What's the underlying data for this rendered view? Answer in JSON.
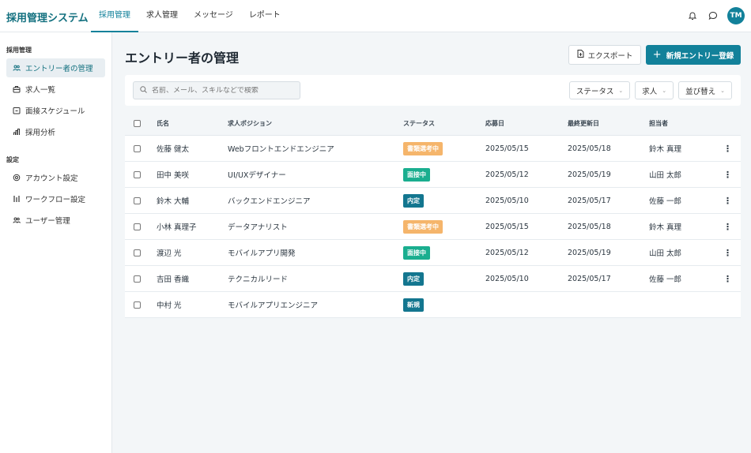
{
  "header": {
    "brand": "採用管理システム",
    "tabs": [
      "採用管理",
      "求人管理",
      "メッセージ",
      "レポート"
    ],
    "avatar": "TM"
  },
  "sidebar": {
    "section1": "採用管理",
    "items1": [
      {
        "label": "エントリー者の管理",
        "icon": "users-icon"
      },
      {
        "label": "求人一覧",
        "icon": "briefcase-icon"
      },
      {
        "label": "面接スケジュール",
        "icon": "calendar-icon"
      },
      {
        "label": "採用分析",
        "icon": "chart-icon"
      }
    ],
    "section2": "設定",
    "items2": [
      {
        "label": "アカウント設定",
        "icon": "gear-icon"
      },
      {
        "label": "ワークフロー設定",
        "icon": "workflow-icon"
      },
      {
        "label": "ユーザー管理",
        "icon": "users-icon"
      }
    ]
  },
  "main": {
    "title": "エントリー者の管理",
    "export_label": "エクスポート",
    "new_label": "新規エントリー登録",
    "search_placeholder": "名前、メール、スキルなどで検索",
    "filters": [
      "ステータス",
      "求人",
      "並び替え"
    ]
  },
  "colors": {
    "accent": "#12819a",
    "review": "#f5b56b",
    "interview": "#1aae8f",
    "offer": "#13768f",
    "new": "#13768f"
  },
  "table": {
    "headers": [
      "氏名",
      "求人ポジション",
      "ステータス",
      "応募日",
      "最終更新日",
      "担当者"
    ],
    "rows": [
      {
        "name": "佐藤 健太",
        "position": "Webフロントエンドエンジニア",
        "status": "書類選考中",
        "status_color": "#f5b56b",
        "applied": "2025/05/15",
        "updated": "2025/05/18",
        "owner": "鈴木 真理"
      },
      {
        "name": "田中 美咲",
        "position": "UI/UXデザイナー",
        "status": "面接中",
        "status_color": "#1aae8f",
        "applied": "2025/05/12",
        "updated": "2025/05/19",
        "owner": "山田 太郎"
      },
      {
        "name": "鈴木 大輔",
        "position": "バックエンドエンジニア",
        "status": "内定",
        "status_color": "#13768f",
        "applied": "2025/05/10",
        "updated": "2025/05/17",
        "owner": "佐藤 一郎"
      },
      {
        "name": "小林 真理子",
        "position": "データアナリスト",
        "status": "書類選考中",
        "status_color": "#f5b56b",
        "applied": "2025/05/15",
        "updated": "2025/05/18",
        "owner": "鈴木 真理"
      },
      {
        "name": "渡辺 光",
        "position": "モバイルアプリ開発",
        "status": "面接中",
        "status_color": "#1aae8f",
        "applied": "2025/05/12",
        "updated": "2025/05/19",
        "owner": "山田 太郎"
      },
      {
        "name": "吉田 香織",
        "position": "テクニカルリード",
        "status": "内定",
        "status_color": "#13768f",
        "applied": "2025/05/10",
        "updated": "2025/05/17",
        "owner": "佐藤 一郎"
      },
      {
        "name": "中村 光",
        "position": "モバイルアプリエンジニア",
        "status": "新規",
        "status_color": "#13768f",
        "applied": "",
        "updated": "",
        "owner": ""
      }
    ]
  }
}
